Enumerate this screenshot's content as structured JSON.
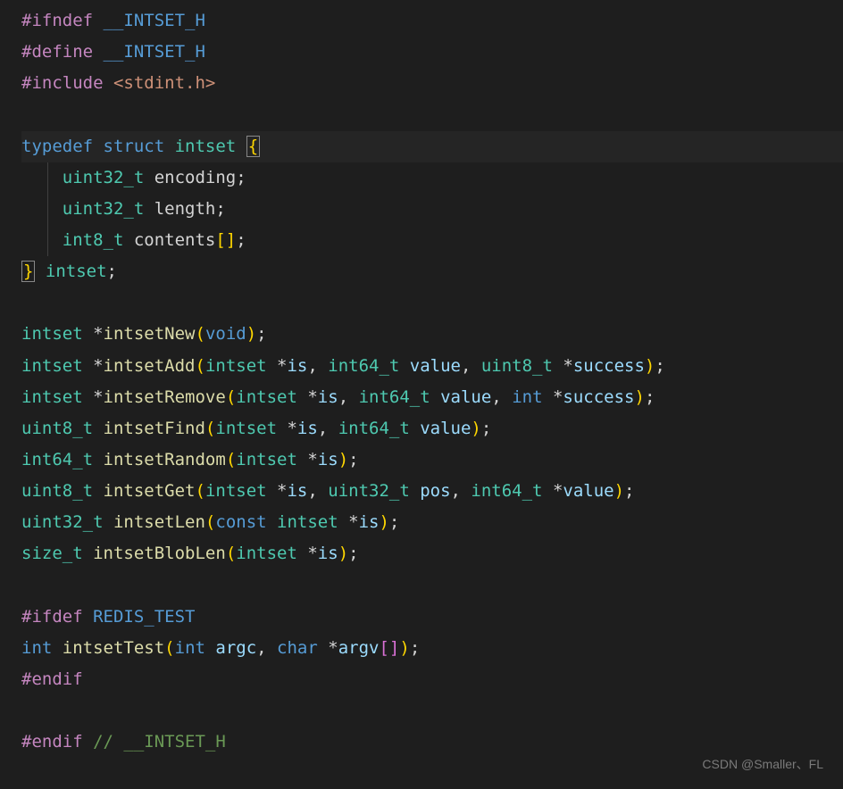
{
  "watermark": "CSDN @Smaller、FL",
  "code": {
    "l1": {
      "directive": "#ifndef",
      "macro": " __INTSET_H"
    },
    "l2": {
      "directive": "#define",
      "macro": " __INTSET_H"
    },
    "l3": {
      "directive": "#include",
      "path": " <stdint.h>"
    },
    "l5": {
      "typedef": "typedef",
      "struct": " struct",
      "name": " intset",
      "brace": "{"
    },
    "l6": {
      "indent": "    ",
      "type": "uint32_t",
      "name": " encoding",
      "semi": ";"
    },
    "l7": {
      "indent": "    ",
      "type": "uint32_t",
      "name": " length",
      "semi": ";"
    },
    "l8": {
      "indent": "    ",
      "type": "int8_t",
      "name": " contents",
      "brackets": "[]",
      "semi": ";"
    },
    "l9": {
      "brace": "}",
      "name": " intset",
      "semi": ";"
    },
    "l11": {
      "type": "intset",
      "star": " *",
      "func": "intsetNew",
      "p1": "(",
      "void": "void",
      "p2": ")",
      "semi": ";"
    },
    "l12": {
      "type": "intset",
      "star": " *",
      "func": "intsetAdd",
      "p1": "(",
      "t1": "intset",
      "s1": " *",
      "a1": "is",
      "c1": ", ",
      "t2": "int64_t",
      "a2": " value",
      "c2": ", ",
      "t3": "uint8_t",
      "s2": " *",
      "a3": "success",
      "p2": ")",
      "semi": ";"
    },
    "l13": {
      "type": "intset",
      "star": " *",
      "func": "intsetRemove",
      "p1": "(",
      "t1": "intset",
      "s1": " *",
      "a1": "is",
      "c1": ", ",
      "t2": "int64_t",
      "a2": " value",
      "c2": ", ",
      "t3": "int",
      "s2": " *",
      "a3": "success",
      "p2": ")",
      "semi": ";"
    },
    "l14": {
      "type": "uint8_t",
      "sp": " ",
      "func": "intsetFind",
      "p1": "(",
      "t1": "intset",
      "s1": " *",
      "a1": "is",
      "c1": ", ",
      "t2": "int64_t",
      "a2": " value",
      "p2": ")",
      "semi": ";"
    },
    "l15": {
      "type": "int64_t",
      "sp": " ",
      "func": "intsetRandom",
      "p1": "(",
      "t1": "intset",
      "s1": " *",
      "a1": "is",
      "p2": ")",
      "semi": ";"
    },
    "l16": {
      "type": "uint8_t",
      "sp": " ",
      "func": "intsetGet",
      "p1": "(",
      "t1": "intset",
      "s1": " *",
      "a1": "is",
      "c1": ", ",
      "t2": "uint32_t",
      "a2": " pos",
      "c2": ", ",
      "t3": "int64_t",
      "s2": " *",
      "a3": "value",
      "p2": ")",
      "semi": ";"
    },
    "l17": {
      "type": "uint32_t",
      "sp": " ",
      "func": "intsetLen",
      "p1": "(",
      "const": "const",
      "sp2": " ",
      "t1": "intset",
      "s1": " *",
      "a1": "is",
      "p2": ")",
      "semi": ";"
    },
    "l18": {
      "type": "size_t",
      "sp": " ",
      "func": "intsetBlobLen",
      "p1": "(",
      "t1": "intset",
      "s1": " *",
      "a1": "is",
      "p2": ")",
      "semi": ";"
    },
    "l20": {
      "directive": "#ifdef",
      "macro": " REDIS_TEST"
    },
    "l21": {
      "type": "int",
      "sp": " ",
      "func": "intsetTest",
      "p1": "(",
      "t1": "int",
      "a1": " argc",
      "c1": ", ",
      "t2": "char",
      "s1": " *",
      "a2": "argv",
      "b1": "[]",
      "p2": ")",
      "semi": ";"
    },
    "l22": {
      "directive": "#endif"
    },
    "l24": {
      "directive": "#endif",
      "comment": " // __INTSET_H"
    }
  }
}
